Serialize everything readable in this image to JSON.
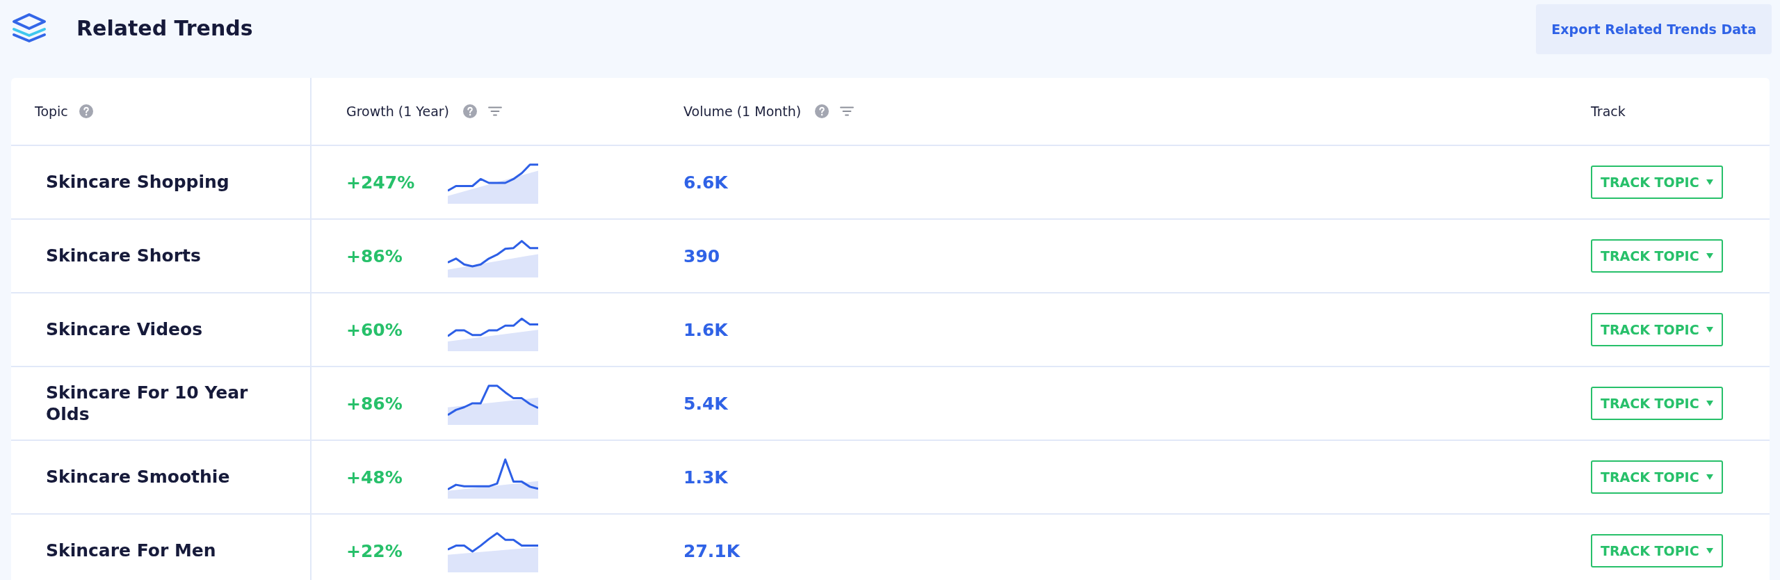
{
  "header": {
    "title": "Related Trends",
    "export_button": "Export Related Trends Data"
  },
  "table": {
    "columns": [
      {
        "label": "Topic",
        "help": true,
        "filter": false
      },
      {
        "label": "Growth (1 Year)",
        "help": true,
        "filter": true
      },
      {
        "label": "Volume (1 Month)",
        "help": true,
        "filter": true
      },
      {
        "label": "Track",
        "help": false,
        "filter": false
      }
    ],
    "rows": [
      {
        "topic": "Skincare Shopping",
        "growth": "+247%",
        "volume": "6.6K",
        "track": "TRACK TOPIC"
      },
      {
        "topic": "Skincare Shorts",
        "growth": "+86%",
        "volume": "390",
        "track": "TRACK TOPIC"
      },
      {
        "topic": "Skincare Videos",
        "growth": "+60%",
        "volume": "1.6K",
        "track": "TRACK TOPIC"
      },
      {
        "topic": "Skincare For 10 Year Olds",
        "growth": "+86%",
        "volume": "5.4K",
        "track": "TRACK TOPIC"
      },
      {
        "topic": "Skincare Smoothie",
        "growth": "+48%",
        "volume": "1.3K",
        "track": "TRACK TOPIC"
      },
      {
        "topic": "Skincare For Men",
        "growth": "+22%",
        "volume": "27.1K",
        "track": "TRACK TOPIC"
      }
    ]
  }
}
